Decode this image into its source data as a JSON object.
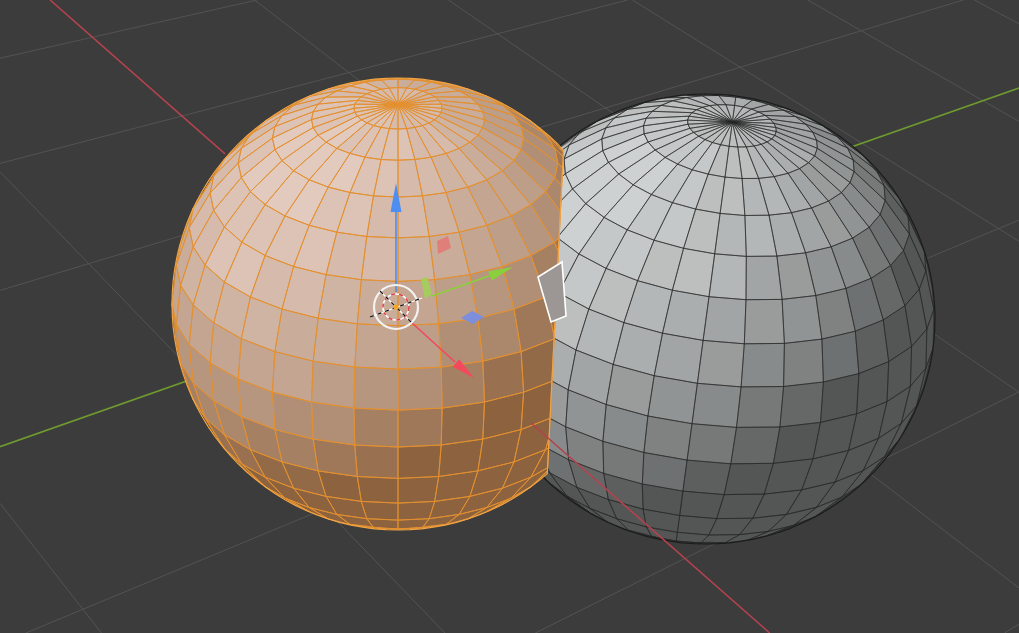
{
  "viewport": {
    "objects": [
      {
        "kind": "uv_sphere",
        "selected": true
      },
      {
        "kind": "uv_sphere",
        "selected": false
      }
    ]
  }
}
